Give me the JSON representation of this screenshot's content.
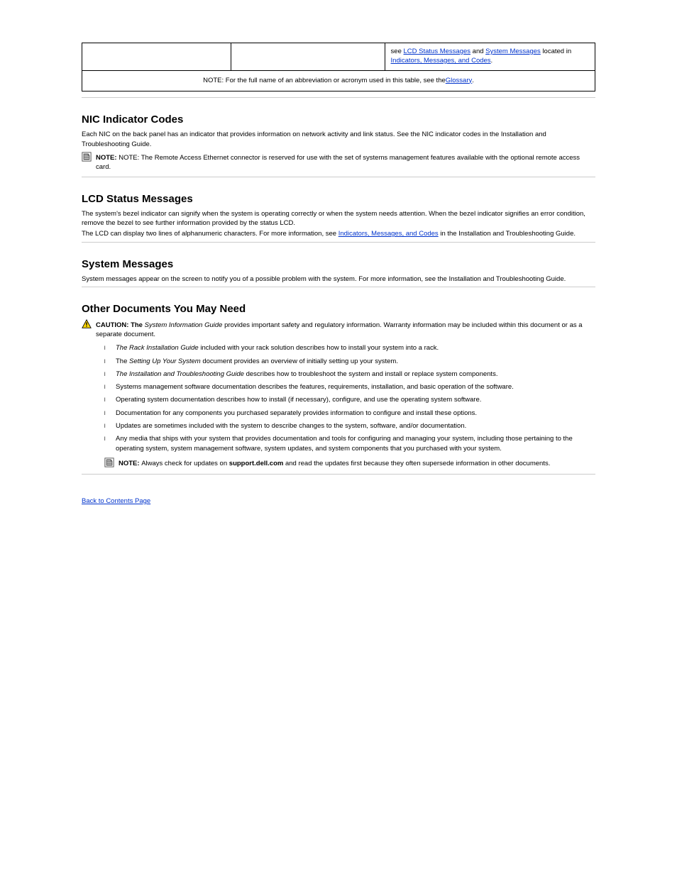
{
  "table": {
    "row1": {
      "col1": "",
      "col2": "",
      "col3_plain_1": "see ",
      "col3_link_1": "LCD Status Messages",
      "col3_plain_2": " and ",
      "col3_link_2": "System Messages",
      "col3_plain_3": " located in ",
      "col3_link_3": "Indicators, Messages, and Codes",
      "col3_plain_4": "."
    },
    "row2": {
      "text_1": "NOTE: For the full name of an abbreviation or acronym used in this table, see the ",
      "link": "Glossary",
      "text_2": "."
    }
  },
  "sections": {
    "nic": {
      "title": "NIC Indicator Codes",
      "body": "Each NIC on the back panel has an indicator that provides information on network activity and link status. See the NIC indicator codes in the Installation and Troubleshooting Guide.",
      "note": "NOTE: The Remote Access Ethernet connector is reserved for use with the set of systems management features available with the optional remote access card."
    },
    "lcd": {
      "title": "LCD Status Messages",
      "body_1": "The system's bezel indicator can signify when the system is operating correctly or when the system needs attention. When the bezel indicator signifies an error condition, remove the bezel to see further information provided by the status LCD.",
      "body_2_1": "The LCD can display two lines of alphanumeric characters. For more information, see ",
      "body_2_link": "Indicators, Messages, and Codes",
      "body_2_2": " in the Installation and Troubleshooting Guide."
    },
    "messages": {
      "title": "System Messages",
      "body": "System messages appear on the screen to notify you of a possible problem with the system. For more information, see the Installation and Troubleshooting Guide."
    },
    "other": {
      "title": "Other Documents You May Need",
      "caution": "CAUTION: The System Information Guide provides important safety and regulatory information. Warranty information may be included within this document or as a separate document.",
      "bullets": [
        {
          "italic": "The Rack Installation Guide",
          "rest": " included with your rack solution describes how to install your system into a rack."
        },
        {
          "italic_1": "The ",
          "italic_2": "Setting Up Your System",
          "rest": " document provides an overview of initially setting up your system."
        },
        {
          "italic": "The Installation and Troubleshooting Guide",
          "rest": " describes how to troubleshoot the system and install or replace system components."
        },
        {
          "plain": "Systems management software documentation describes the features, requirements, installation, and basic operation of the software."
        },
        {
          "plain": "Operating system documentation describes how to install (if necessary), configure, and use the operating system software."
        },
        {
          "plain": "Documentation for any components you purchased separately provides information to configure and install these options."
        },
        {
          "plain": "Updates are sometimes included with the system to describe changes to the system, software, and/or documentation."
        },
        {
          "plain_long": "Any media that ships with your system that provides documentation and tools for configuring and managing your system, including those pertaining to the operating system, system management software, system updates, and system components that you purchased with your system."
        }
      ],
      "note": "NOTE: Always check for updates on support.dell.com and read the updates first because they often supersede information in other documents."
    }
  },
  "back_link": "Back to Contents Page"
}
